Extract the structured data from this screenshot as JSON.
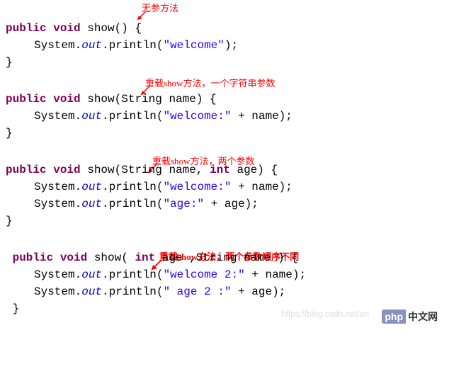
{
  "annotations": {
    "a1": "无参方法",
    "a2": "重载show方法，一个字符串参数",
    "a3": "重载show方法，两个参数",
    "a4": "重载show方法，两个参数顺序不同"
  },
  "code": {
    "m1": {
      "sig_prefix": "public void",
      "sig_name": " show() {",
      "body1_a": "System.",
      "body1_b": "out",
      "body1_c": ".println(",
      "body1_d": "\"welcome\"",
      "body1_e": ");",
      "close": "}"
    },
    "m2": {
      "sig_prefix": "public void",
      "sig_name": " show(String name) {",
      "body1_a": "System.",
      "body1_b": "out",
      "body1_c": ".println(",
      "body1_d": "\"welcome:\"",
      "body1_e": " + name);",
      "close": "}"
    },
    "m3": {
      "sig_prefix": "public void",
      "sig_mid1": " show(String name, ",
      "sig_kw2": "int",
      "sig_mid2": " age) {",
      "body1_a": "System.",
      "body1_b": "out",
      "body1_c": ".println(",
      "body1_d": "\"welcome:\"",
      "body1_e": " + name);",
      "body2_a": "System.",
      "body2_b": "out",
      "body2_c": ".println(",
      "body2_d": "\"age:\"",
      "body2_e": " + age);",
      "close": "}"
    },
    "m4": {
      "sig_prefix": " public void",
      "sig_mid1": " show( ",
      "sig_kw2": "int",
      "sig_mid2": " age ,String name ) {",
      "body1_a": "System.",
      "body1_b": "out",
      "body1_c": ".println(",
      "body1_d": "\"welcome 2:\"",
      "body1_e": " + name);",
      "body2_a": "System.",
      "body2_b": "out",
      "body2_c": ".println(",
      "body2_d": "\" age 2 :\"",
      "body2_e": " + age);",
      "close": " }"
    }
  },
  "watermark": "https://blog.csdn.net/an",
  "logo": {
    "p": "php",
    "t": "中文网"
  }
}
